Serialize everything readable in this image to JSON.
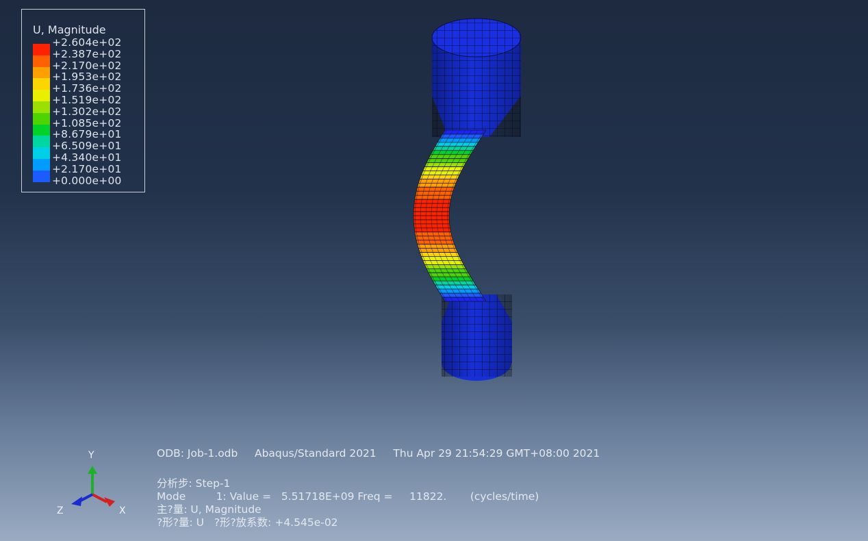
{
  "legend": {
    "title": "U, Magnitude",
    "levels": [
      {
        "label": "+2.604e+02",
        "color": "#ff2200"
      },
      {
        "label": "+2.387e+02",
        "color": "#ff6000"
      },
      {
        "label": "+2.170e+02",
        "color": "#ffa000"
      },
      {
        "label": "+1.953e+02",
        "color": "#ffd500"
      },
      {
        "label": "+1.736e+02",
        "color": "#e8f000"
      },
      {
        "label": "+1.519e+02",
        "color": "#9be000"
      },
      {
        "label": "+1.302e+02",
        "color": "#4ed400"
      },
      {
        "label": "+1.085e+02",
        "color": "#00d22a"
      },
      {
        "label": "+8.679e+01",
        "color": "#00d7a0"
      },
      {
        "label": "+6.509e+01",
        "color": "#00cfe8"
      },
      {
        "label": "+4.340e+01",
        "color": "#009cff"
      },
      {
        "label": "+2.170e+01",
        "color": "#1a5cff"
      },
      {
        "label": "+0.000e+00",
        "color": "#1a23ff"
      }
    ]
  },
  "triad": {
    "y_label": "Y",
    "z_label": "Z",
    "x_label": "X"
  },
  "info": {
    "line1": "ODB: Job-1.odb     Abaqus/Standard 2021     Thu Apr 29 21:54:29 GMT+08:00 2021",
    "line2": "分析步: Step-1",
    "line3": "Mode         1: Value =   5.51718E+09 Freq =     11822.       (cycles/time)",
    "line4": "主?量: U, Magnitude",
    "line5": "?形?量: U   ?形?放系数: +4.545e-02"
  },
  "colors": {
    "background_top": "#1d2a40",
    "background_bottom": "#9aabc2",
    "model_base": "#1730d8"
  }
}
